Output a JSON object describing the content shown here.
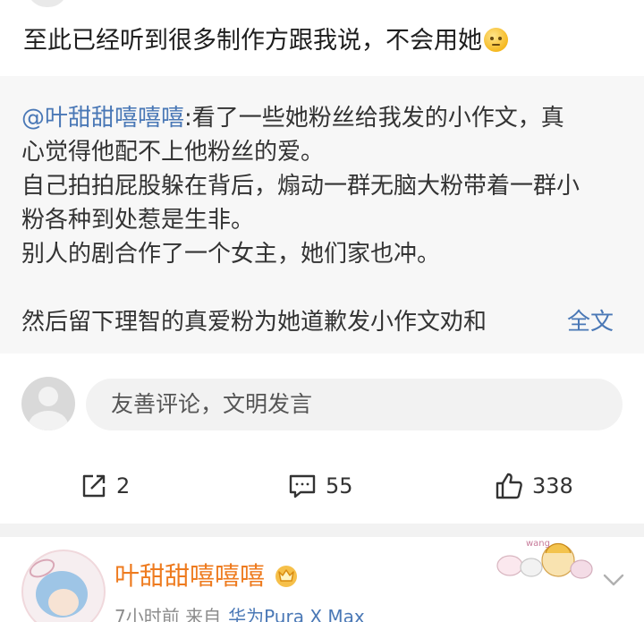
{
  "post": {
    "text": "至此已经听到很多制作方跟我说，不会用她",
    "emoji_icon": "thinking-face-emoji"
  },
  "repost": {
    "mention": "@叶甜甜嘻嘻嘻",
    "line1_rest": ":看了一些她粉丝给我发的小作文，真",
    "line2": "心觉得他配不上他粉丝的爱。",
    "line3": "自己拍拍屁股躲在背后，煽动一群无脑大粉带着一群小",
    "line4": "粉各种到处惹是生非。",
    "line5": "别人的剧合作了一个女主，她们家也冲。",
    "line6": "然后留下理智的真爱粉为她道歉发小作文劝和",
    "more_label": "全文"
  },
  "comment_box": {
    "placeholder": "友善评论，文明发言"
  },
  "actions": {
    "share_count": "2",
    "comment_count": "55",
    "like_count": "338"
  },
  "user": {
    "name": "叶甜甜嘻嘻嘻",
    "time": "7小时前",
    "source_label": "来自",
    "device": "华为Pura X Max",
    "sticker_text": "wang"
  },
  "colors": {
    "link": "#4a78b6",
    "username": "#ee7b1f",
    "repost_bg": "#f7f7f7",
    "page_bg": "#f2f2f2"
  }
}
